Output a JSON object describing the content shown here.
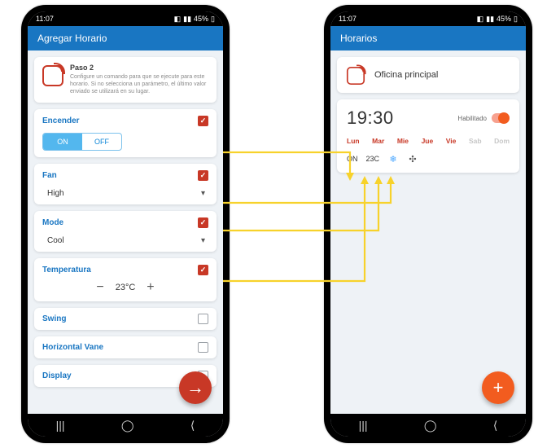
{
  "status": {
    "time": "11:07",
    "battery": "45%"
  },
  "left": {
    "title": "Agregar Horario",
    "intro": {
      "title": "Paso 2",
      "body": "Configure un comando para que se ejecute para este horario. Si no selecciona un parámetro, el último valor enviado se utilizará en su lugar."
    },
    "encender": {
      "label": "Encender",
      "checked": true,
      "on": "ON",
      "off": "OFF",
      "value": "ON"
    },
    "fan": {
      "label": "Fan",
      "checked": true,
      "value": "High"
    },
    "mode": {
      "label": "Mode",
      "checked": true,
      "value": "Cool"
    },
    "temp": {
      "label": "Temperatura",
      "checked": true,
      "value": "23°C"
    },
    "swing": {
      "label": "Swing",
      "checked": false
    },
    "hvane": {
      "label": "Horizontal Vane",
      "checked": false
    },
    "display": {
      "label": "Display",
      "checked": false
    }
  },
  "right": {
    "title": "Horarios",
    "location": "Oficina principal",
    "schedule": {
      "time": "19:30",
      "enabled_label": "Habilitado",
      "days": [
        {
          "label": "Lun",
          "on": true
        },
        {
          "label": "Mar",
          "on": true
        },
        {
          "label": "Mie",
          "on": true
        },
        {
          "label": "Jue",
          "on": true
        },
        {
          "label": "Vie",
          "on": true
        },
        {
          "label": "Sab",
          "on": false
        },
        {
          "label": "Dom",
          "on": false
        }
      ],
      "summary": {
        "power": "ON",
        "temp": "23C"
      }
    }
  },
  "nav": {
    "recents": "|||",
    "home": "◯",
    "back": "⟨"
  }
}
